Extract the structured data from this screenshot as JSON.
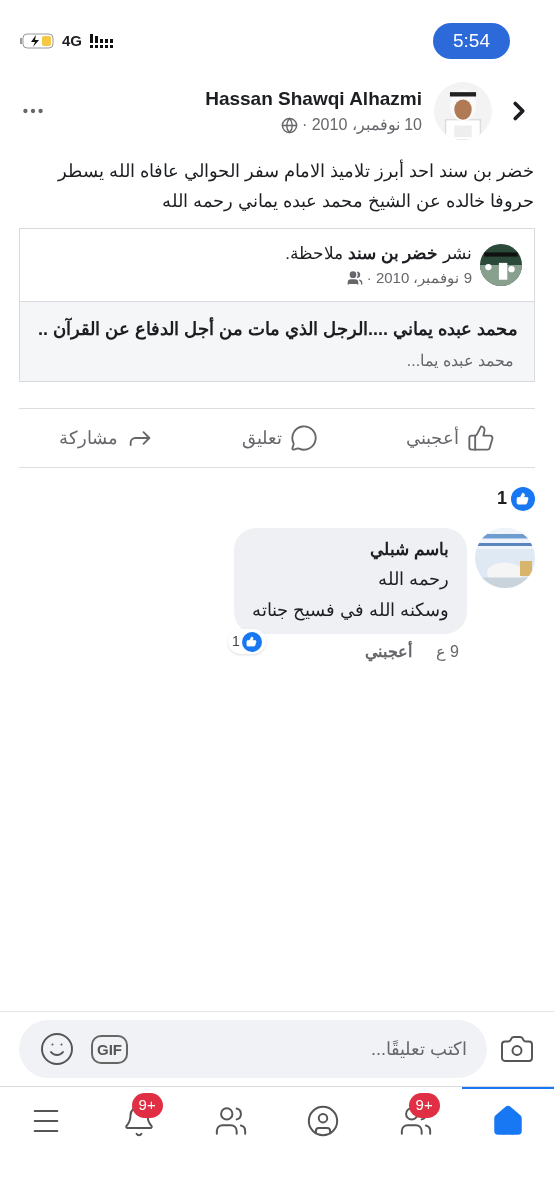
{
  "status_bar": {
    "time": "5:54",
    "network": "4G"
  },
  "post": {
    "author": "Hassan Shawqi Alhazmi",
    "date": "10 نوفمبر، 2010 ·",
    "text": "خضر بن سند احد أبرز تلاميذ الامام سفر الحوالي عافاه الله يسطر حروفا خالده عن الشيخ محمد عبده يماني رحمه الله",
    "shared": {
      "header": "نشر **خضر بن سند** ملاحظة.",
      "date": "9 نوفمبر، 2010 ·",
      "title": "محمد عبده يماني ....الرجل الذي مات من أجل الدفاع عن القرآن ..",
      "excerpt": "محمد عبده يما..."
    },
    "actions": [
      {
        "kind": "like",
        "label": "أعجبني"
      },
      {
        "kind": "comment",
        "label": "تعليق"
      },
      {
        "kind": "share",
        "label": "مشاركة"
      }
    ],
    "reaction_count": "1"
  },
  "comments": [
    {
      "author": "باسم شبلي",
      "lines": [
        "رحمه الله",
        "وسكنه الله في فسيح جناته"
      ],
      "reaction_count": "1",
      "time": "9 ع",
      "like": "أعجبني"
    }
  ],
  "composer": {
    "placeholder": "اكتب تعليقًا...",
    "gif_label": "GIF"
  },
  "tab_bar": [
    {
      "kind": "home",
      "selected": true
    },
    {
      "kind": "friends",
      "selected": false,
      "badge": "9+"
    },
    {
      "kind": "profile",
      "selected": false
    },
    {
      "kind": "groups",
      "selected": false
    },
    {
      "kind": "notifications",
      "selected": false,
      "badge": "9+"
    },
    {
      "kind": "menu",
      "selected": false
    }
  ]
}
